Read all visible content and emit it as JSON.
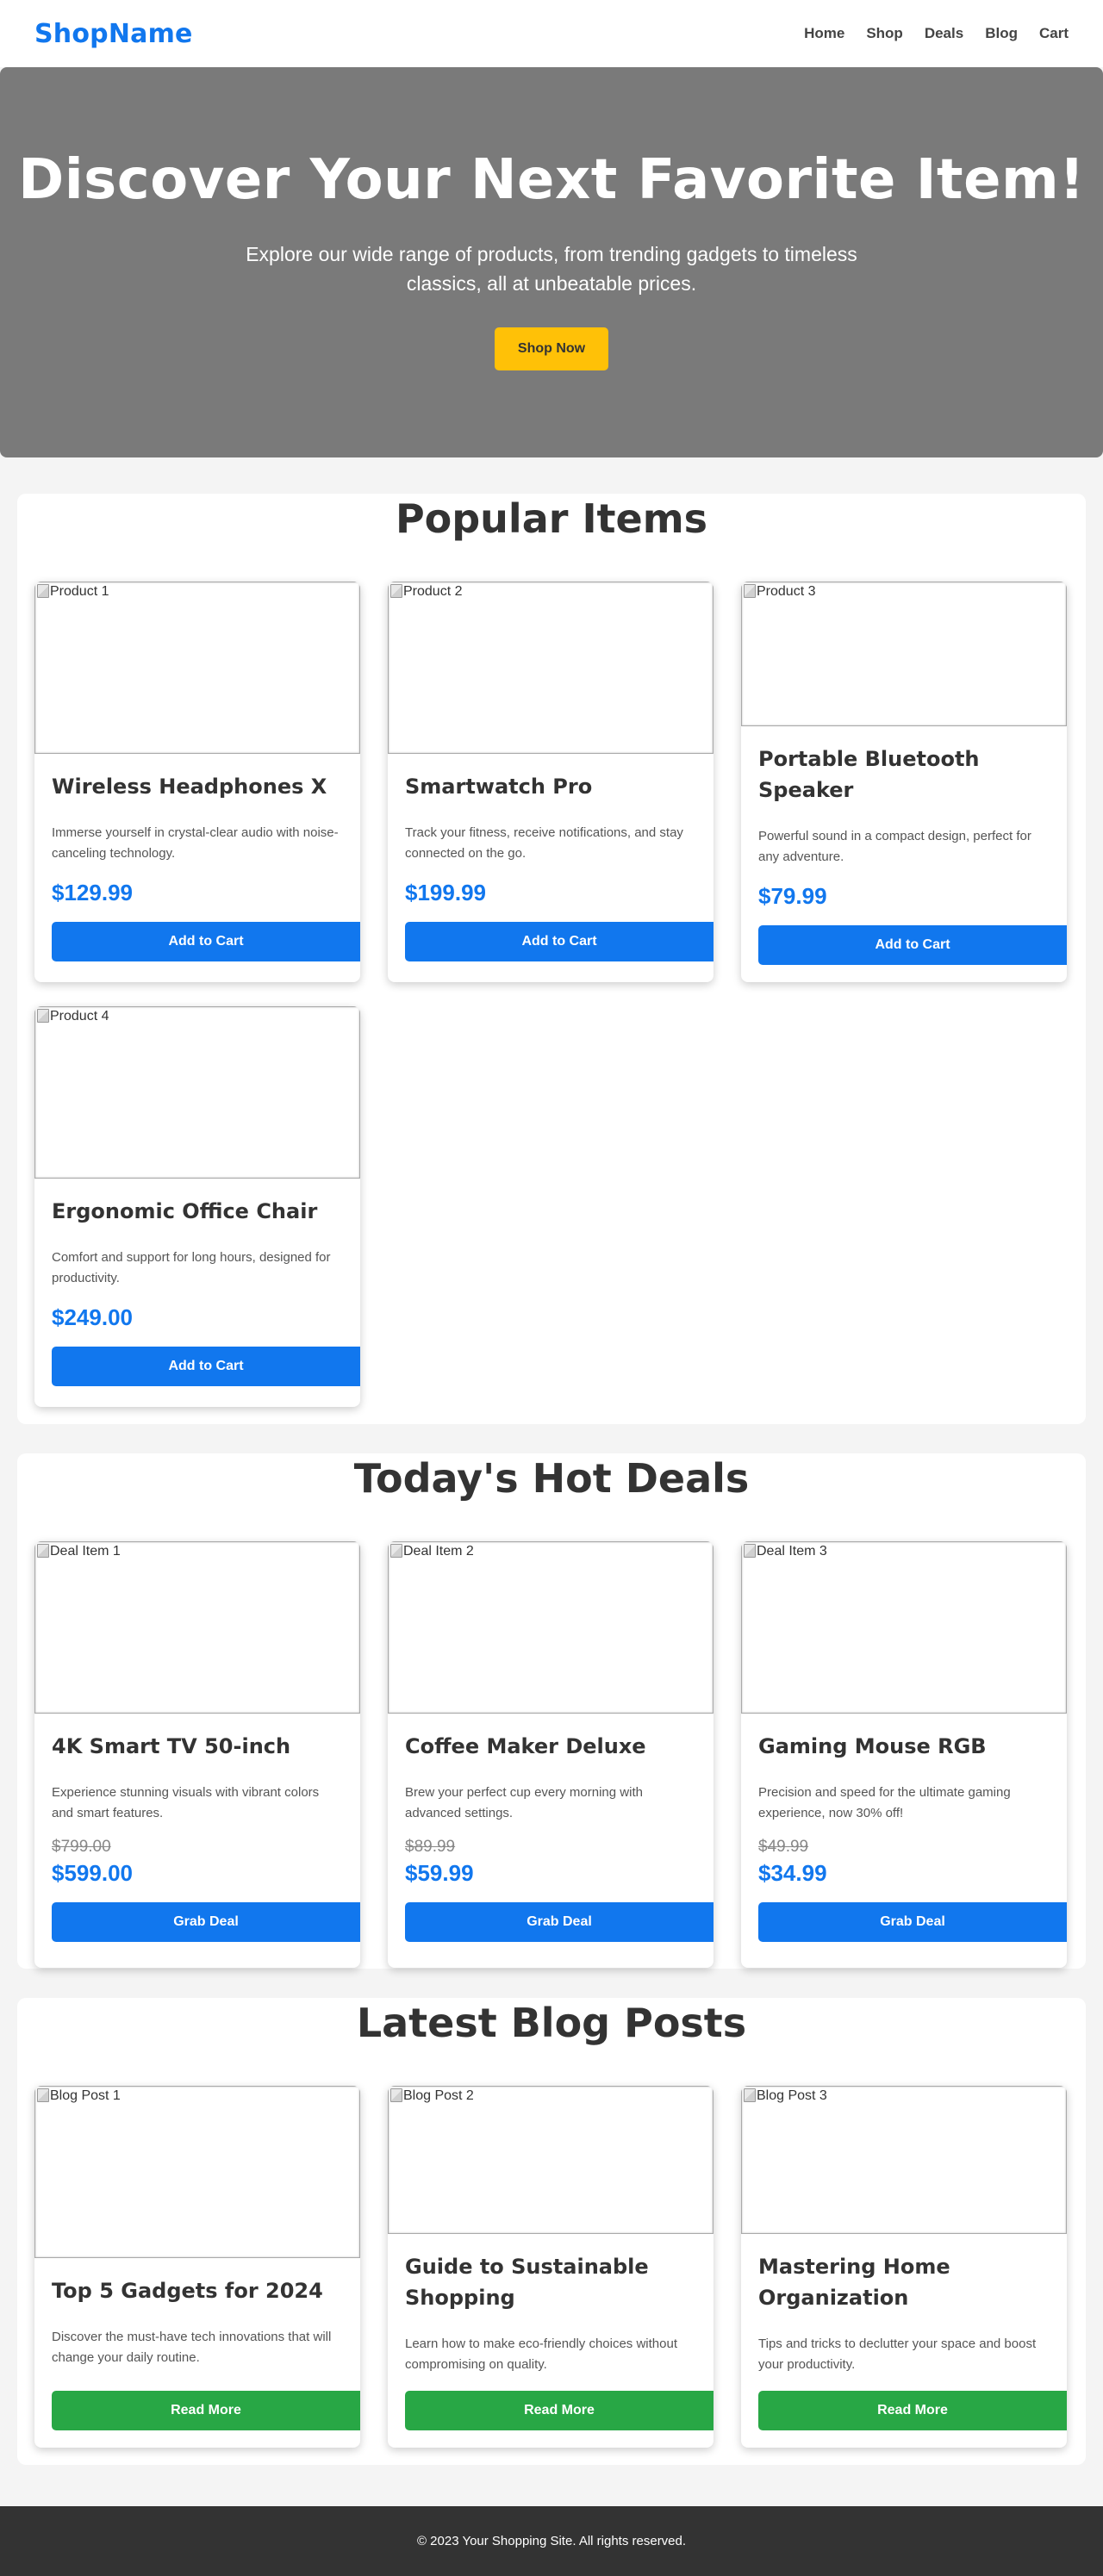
{
  "header": {
    "logo": "ShopName",
    "nav": [
      "Home",
      "Shop",
      "Deals",
      "Blog",
      "Cart"
    ]
  },
  "hero": {
    "title": "Discover Your Next Favorite Item!",
    "subtitle": "Explore our wide range of products, from trending gadgets to timeless classics, all at unbeatable prices.",
    "button": "Shop Now"
  },
  "popular": {
    "title": "Popular Items",
    "items": [
      {
        "alt": "Product 1",
        "name": "Wireless Headphones X",
        "desc": "Immerse yourself in crystal-clear audio with noise-canceling technology.",
        "price": "$129.99",
        "button": "Add to Cart"
      },
      {
        "alt": "Product 2",
        "name": "Smartwatch Pro",
        "desc": "Track your fitness, receive notifications, and stay connected on the go.",
        "price": "$199.99",
        "button": "Add to Cart"
      },
      {
        "alt": "Product 3",
        "name": "Portable Bluetooth Speaker",
        "desc": "Powerful sound in a compact design, perfect for any adventure.",
        "price": "$79.99",
        "button": "Add to Cart"
      },
      {
        "alt": "Product 4",
        "name": "Ergonomic Office Chair",
        "desc": "Comfort and support for long hours, designed for productivity.",
        "price": "$249.00",
        "button": "Add to Cart"
      }
    ]
  },
  "deals": {
    "title": "Today's Hot Deals",
    "items": [
      {
        "alt": "Deal Item 1",
        "name": "4K Smart TV 50-inch",
        "desc": "Experience stunning visuals with vibrant colors and smart features.",
        "old_price": "$799.00",
        "price": "$599.00",
        "button": "Grab Deal"
      },
      {
        "alt": "Deal Item 2",
        "name": "Coffee Maker Deluxe",
        "desc": "Brew your perfect cup every morning with advanced settings.",
        "old_price": "$89.99",
        "price": "$59.99",
        "button": "Grab Deal"
      },
      {
        "alt": "Deal Item 3",
        "name": "Gaming Mouse RGB",
        "desc": "Precision and speed for the ultimate gaming experience, now 30% off!",
        "old_price": "$49.99",
        "price": "$34.99",
        "button": "Grab Deal"
      }
    ]
  },
  "blog": {
    "title": "Latest Blog Posts",
    "posts": [
      {
        "alt": "Blog Post 1",
        "title": "Top 5 Gadgets for 2024",
        "desc": "Discover the must-have tech innovations that will change your daily routine.",
        "button": "Read More"
      },
      {
        "alt": "Blog Post 2",
        "title": "Guide to Sustainable Shopping",
        "desc": "Learn how to make eco-friendly choices without compromising on quality.",
        "button": "Read More"
      },
      {
        "alt": "Blog Post 3",
        "title": "Mastering Home Organization",
        "desc": "Tips and tricks to declutter your space and boost your productivity.",
        "button": "Read More"
      }
    ]
  },
  "footer": {
    "text": "© 2023 Your Shopping Site. All rights reserved."
  },
  "colors": {
    "brand": "#1177ee",
    "hero_button": "#ffc107",
    "blog_button": "#28a745",
    "footer_bg": "#333333"
  },
  "icons": {
    "broken_image": "broken-image-icon"
  }
}
